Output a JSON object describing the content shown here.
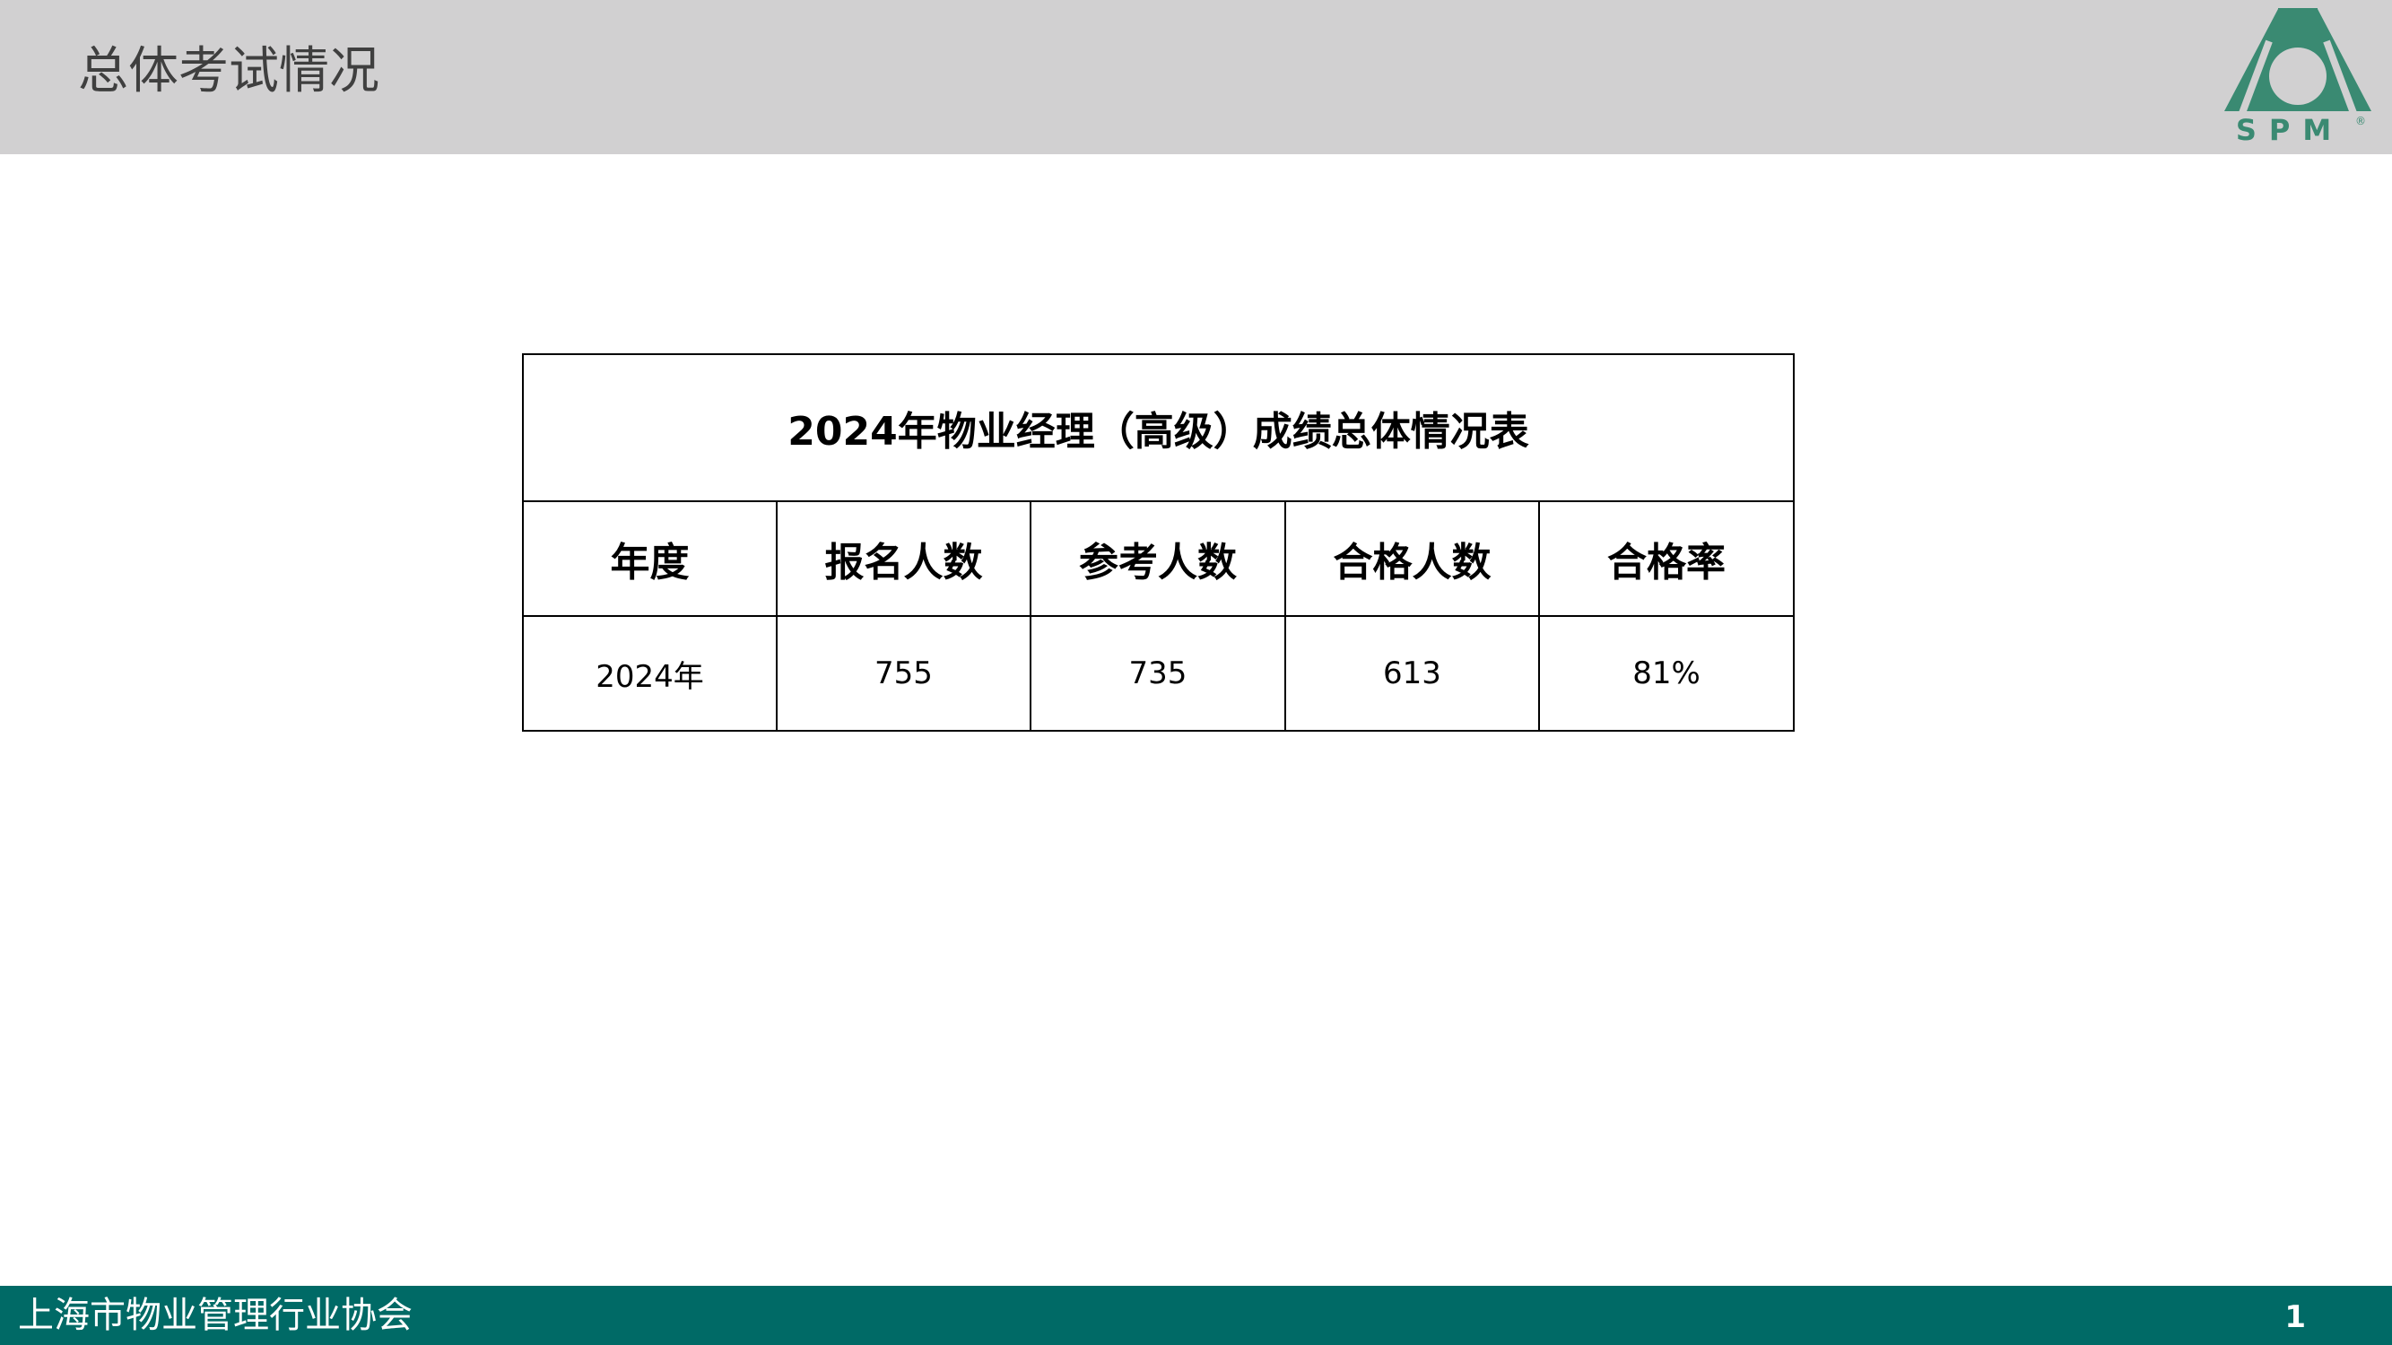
{
  "header": {
    "title": "总体考试情况",
    "logo": {
      "text": "SPM",
      "registered_mark": "®",
      "color": "#3a8a72"
    },
    "background_color": "#d1d0d1"
  },
  "table": {
    "caption": "2024年物业经理（高级）成绩总体情况表",
    "columns": [
      "年度",
      "报名人数",
      "参考人数",
      "合格人数",
      "合格率"
    ],
    "rows": [
      [
        "2024年",
        "755",
        "735",
        "613",
        "81%"
      ]
    ]
  },
  "footer": {
    "organization": "上海市物业管理行业协会",
    "page_number": "1",
    "background_color": "#006a66"
  }
}
